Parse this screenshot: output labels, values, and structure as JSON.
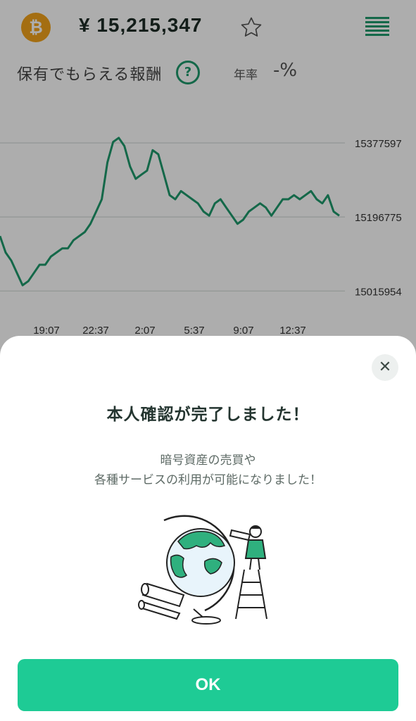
{
  "header": {
    "coin_symbol": "₿",
    "price": "¥ 15,215,347"
  },
  "reward": {
    "label": "保有でもらえる報酬",
    "help_symbol": "?",
    "annual_label": "年率",
    "annual_value": "-%"
  },
  "chart_data": {
    "type": "line",
    "x": [
      "19:07",
      "22:37",
      "2:07",
      "5:37",
      "9:07",
      "12:37"
    ],
    "y_ticks": [
      15377597,
      15196775,
      15015954
    ],
    "ylim": [
      14970000,
      15400000
    ],
    "series_color": "#1e9a6c",
    "grid": true,
    "values": [
      15150000,
      15110000,
      15090000,
      15060000,
      15030000,
      15040000,
      15060000,
      15080000,
      15080000,
      15100000,
      15110000,
      15120000,
      15120000,
      15140000,
      15150000,
      15160000,
      15180000,
      15210000,
      15240000,
      15330000,
      15380000,
      15390000,
      15370000,
      15320000,
      15290000,
      15300000,
      15310000,
      15360000,
      15350000,
      15300000,
      15250000,
      15240000,
      15260000,
      15250000,
      15240000,
      15230000,
      15210000,
      15200000,
      15230000,
      15240000,
      15220000,
      15200000,
      15180000,
      15190000,
      15210000,
      15220000,
      15230000,
      15220000,
      15200000,
      15220000,
      15240000,
      15240000,
      15250000,
      15240000,
      15250000,
      15260000,
      15240000,
      15230000,
      15250000,
      15210000,
      15200000
    ]
  },
  "modal": {
    "close_symbol": "✕",
    "title": "本人確認が完了しました！",
    "message_line1": "暗号資産の売買や",
    "message_line2": "各種サービスの利用が可能になりました！",
    "ok_label": "OK"
  },
  "colors": {
    "accent": "#1ecb95",
    "brand_green": "#1e9a6c",
    "coin": "#f2a31b"
  }
}
